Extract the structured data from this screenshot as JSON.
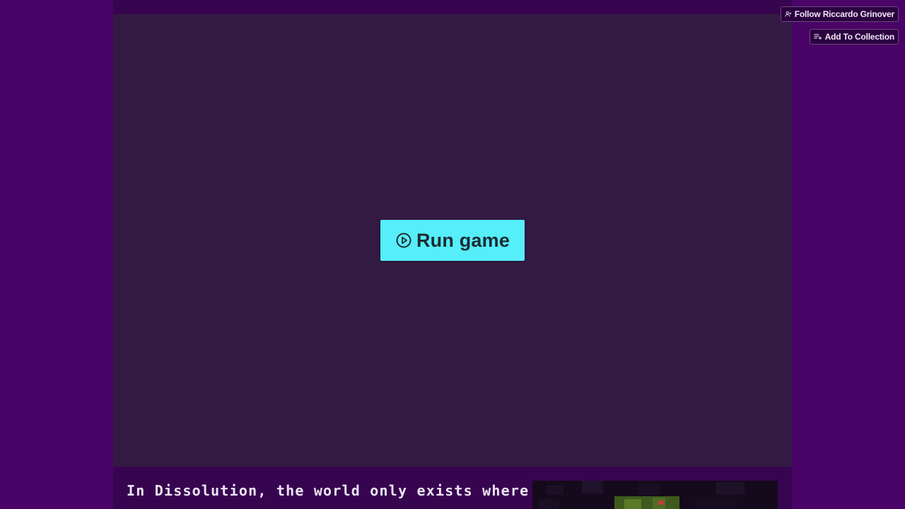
{
  "page": {
    "colors": {
      "page_background": "#4a0367",
      "column_background": "#370550",
      "game_frame_background": "#331a42",
      "run_button_background": "#55eef9",
      "run_button_text": "#1c2b33",
      "description_text": "#ece4f2"
    }
  },
  "header_actions": {
    "follow": {
      "label": "Follow Riccardo Grinover",
      "icon": "add-user-icon"
    },
    "add_to_collection": {
      "label": "Add To Collection",
      "icon": "playlist-add-icon"
    }
  },
  "game": {
    "run_button": {
      "label": "Run game",
      "icon": "play-circle-icon"
    }
  },
  "description": {
    "text": "In Dissolution, the world only exists where"
  }
}
